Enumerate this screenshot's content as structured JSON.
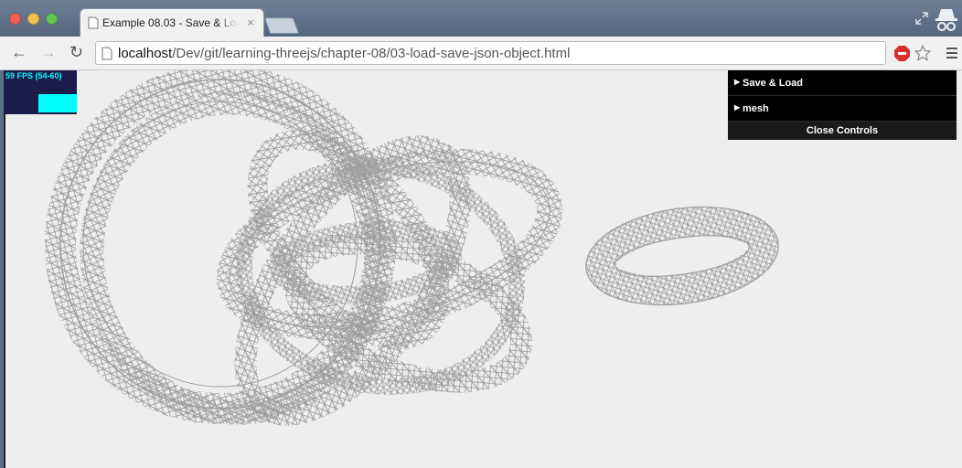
{
  "browser": {
    "tab_title": "Example 08.03 - Save & Load",
    "tab_close": "×",
    "url_host": "localhost",
    "url_path": "/Dev/git/learning-threejs/chapter-08/03-load-save-json-object.html"
  },
  "stats": {
    "fps_text": "59 FPS (54-60)"
  },
  "gui": {
    "folders": [
      {
        "label": "Save & Load"
      },
      {
        "label": "mesh"
      }
    ],
    "close_label": "Close Controls"
  },
  "colors": {
    "wireframe": "#9e9e9e",
    "canvas_bg": "#eeeeee",
    "stats_fg": "#00ffff"
  }
}
